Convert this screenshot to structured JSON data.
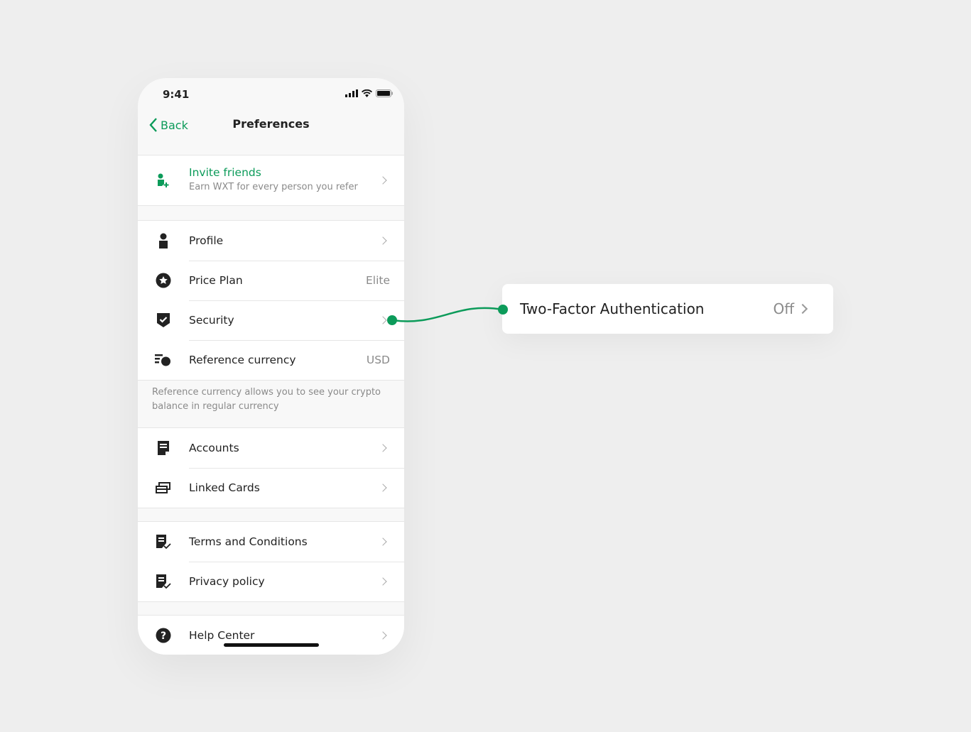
{
  "status": {
    "time": "9:41",
    "icons": [
      "signal-icon",
      "wifi-icon",
      "battery-icon"
    ]
  },
  "nav": {
    "back_label": "Back",
    "title": "Preferences"
  },
  "invite": {
    "title": "Invite friends",
    "subtitle": "Earn WXT for every person you refer",
    "icon": "add-user-icon"
  },
  "account_section": [
    {
      "label": "Profile",
      "icon": "user-icon"
    },
    {
      "label": "Price Plan",
      "value": "Elite",
      "icon": "star-icon"
    },
    {
      "label": "Security",
      "icon": "shield-check-icon"
    },
    {
      "label": "Reference currency",
      "value": "USD",
      "icon": "currency-icon"
    }
  ],
  "note": "Reference currency allows you to see your crypto balance in regular currency",
  "finance_section": [
    {
      "label": "Accounts",
      "icon": "document-icon"
    },
    {
      "label": "Linked Cards",
      "icon": "cards-icon"
    }
  ],
  "legal_section": [
    {
      "label": "Terms and Conditions",
      "icon": "document-check-icon"
    },
    {
      "label": "Privacy policy",
      "icon": "document-check-icon"
    }
  ],
  "help_section": [
    {
      "label": "Help Center",
      "icon": "question-icon"
    }
  ],
  "callout": {
    "title": "Two-Factor Authentication",
    "value": "Off"
  },
  "colors": {
    "accent": "#0c9b5a",
    "background": "#eeeeee"
  }
}
